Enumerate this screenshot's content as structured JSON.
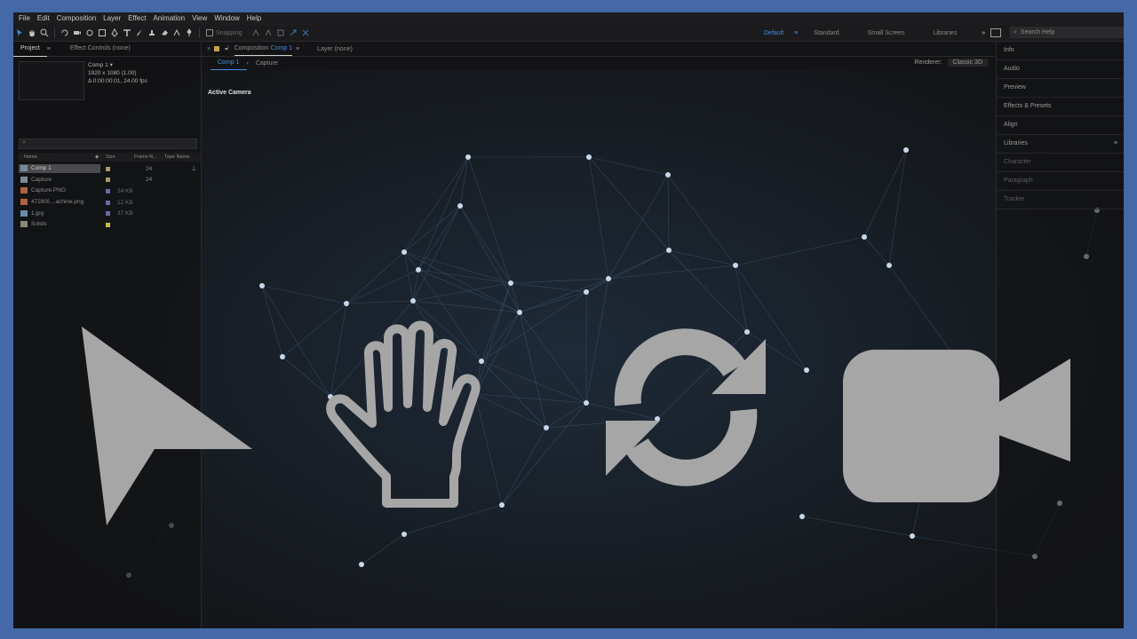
{
  "menu": [
    "File",
    "Edit",
    "Composition",
    "Layer",
    "Effect",
    "Animation",
    "View",
    "Window",
    "Help"
  ],
  "toolbar": {
    "snapping": "Snapping",
    "workspaces": [
      "Default",
      "Standard",
      "Small Screen",
      "Libraries"
    ],
    "active_workspace": "Default",
    "search_placeholder": "Search Help"
  },
  "project": {
    "tab": "Project",
    "effect_controls_tab": "Effect Controls (none)",
    "selected_comp": {
      "name": "Comp 1",
      "dims": "1920 x 1080 (1.00)",
      "duration": "Δ 0:00:00:01, 24.00 fps"
    },
    "headers": {
      "name": "Name",
      "size": "Size",
      "frame_rate": "Frame R...",
      "tape_name": "Tape Name"
    },
    "items": [
      {
        "name": "Comp 1",
        "size": "",
        "frame_rate": "24",
        "label_color": "#a89a6a",
        "icon_color": "#7a8a9a",
        "selected": true
      },
      {
        "name": "Capture",
        "size": "",
        "frame_rate": "24",
        "label_color": "#a89a6a",
        "icon_color": "#7a8a9a",
        "selected": false
      },
      {
        "name": "Capture.PNG",
        "size": "24 KB",
        "frame_rate": "",
        "label_color": "#6a6aa8",
        "icon_color": "#b06040",
        "selected": false
      },
      {
        "name": "47280f-...achine.png",
        "size": "12 KB",
        "frame_rate": "",
        "label_color": "#6a6aa8",
        "icon_color": "#b06040",
        "selected": false
      },
      {
        "name": "1.jpg",
        "size": "37 KB",
        "frame_rate": "",
        "label_color": "#6a6aa8",
        "icon_color": "#6a8aaa",
        "selected": false
      },
      {
        "name": "Solids",
        "size": "",
        "frame_rate": "",
        "label_color": "#c8b84a",
        "icon_color": "#8a8a7a",
        "selected": false
      }
    ]
  },
  "composition": {
    "tab_prefix": "Composition",
    "tab_name": "Comp 1",
    "layer_tab": "Layer (none)",
    "sub_tabs": [
      "Comp 1",
      "Capture"
    ],
    "renderer_label": "Renderer:",
    "renderer_value": "Classic 3D",
    "view_label": "Active Camera"
  },
  "right_panel": {
    "items": [
      {
        "label": "Info",
        "dim": false
      },
      {
        "label": "Audio",
        "dim": false
      },
      {
        "label": "Preview",
        "dim": false
      },
      {
        "label": "Effects & Presets",
        "dim": false
      },
      {
        "label": "Align",
        "dim": false
      },
      {
        "label": "Libraries",
        "dim": false
      },
      {
        "label": "Character",
        "dim": true
      },
      {
        "label": "Paragraph",
        "dim": true
      },
      {
        "label": "Tracker",
        "dim": true
      }
    ]
  },
  "big_icons": [
    "selection-arrow-icon",
    "hand-icon",
    "refresh-icon",
    "video-camera-icon"
  ],
  "colors": {
    "accent": "#3f8fe0",
    "border": "#4468a8",
    "icon_gray": "#a6a6a6"
  }
}
